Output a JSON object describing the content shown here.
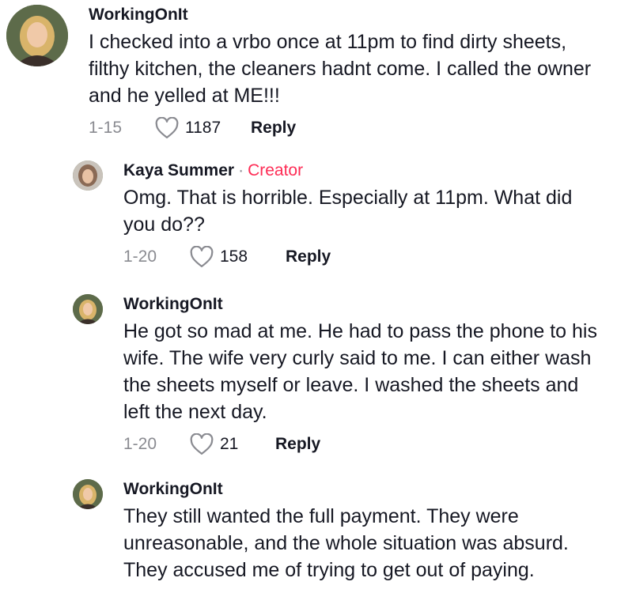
{
  "comments": [
    {
      "username": "WorkingOnIt",
      "text": "I checked into a vrbo once at 11pm to find dirty sheets, filthy kitchen, the cleaners hadnt come. I called the owner and he yelled at ME!!!",
      "date": "1-15",
      "likes": "1187",
      "reply_label": "Reply"
    },
    {
      "username": "Kaya Summer",
      "separator": "·",
      "badge": "Creator",
      "text": "Omg. That is horrible. Especially at 11pm. What did you do??",
      "date": "1-20",
      "likes": "158",
      "reply_label": "Reply"
    },
    {
      "username": "WorkingOnIt",
      "text": "He got so mad at me. He had to pass the phone to his wife. The wife very curly said to me. I can either wash the sheets myself or leave. I washed the sheets and left the next day.",
      "date": "1-20",
      "likes": "21",
      "reply_label": "Reply"
    },
    {
      "username": "WorkingOnIt",
      "text": "They still wanted the full payment. They were unreasonable, and the whole situation was absurd. They accused me of trying to get out of paying."
    }
  ],
  "icons": {
    "like": "heart-outline-icon"
  },
  "colors": {
    "creator_badge": "#fe2c55",
    "meta_text": "#8a8b91",
    "primary_text": "#161823"
  }
}
